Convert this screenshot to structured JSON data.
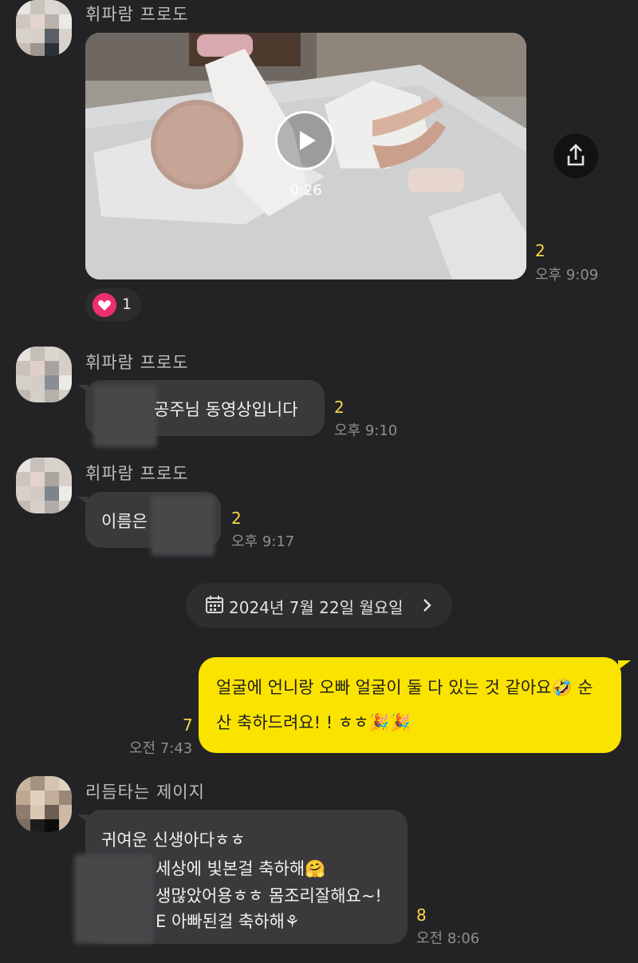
{
  "messages": [
    {
      "sender": "휘파람 프로도",
      "video_duration": "0:26",
      "unread": "2",
      "time": "오후 9:09",
      "reaction_count": "1"
    },
    {
      "sender": "휘파람 프로도",
      "text": "공주님 동영상입니다",
      "unread": "2",
      "time": "오후 9:10"
    },
    {
      "sender": "휘파람 프로도",
      "text": "이름은",
      "unread": "2",
      "time": "오후 9:17"
    }
  ],
  "date_divider": {
    "label": "2024년 7월 22일 월요일"
  },
  "my_message": {
    "line1": "얼굴에 언니랑 오빠 얼굴이 둘 다 있는 것 같아요🤣 순",
    "line2": "산 축하드려요! ! ㅎㅎ🎉🎉",
    "unread": "7",
    "time": "오전 7:43"
  },
  "reply": {
    "sender": "리듬타는 제이지",
    "line1": "귀여운 신생아다ㅎㅎ",
    "line2": "세상에 빛본걸 축하해🤗",
    "line3": "생많았어용ㅎㅎ 몸조리잘해요~!",
    "line4": "E 아빠된걸 축하해⚘",
    "unread": "8",
    "time": "오전 8:06"
  }
}
